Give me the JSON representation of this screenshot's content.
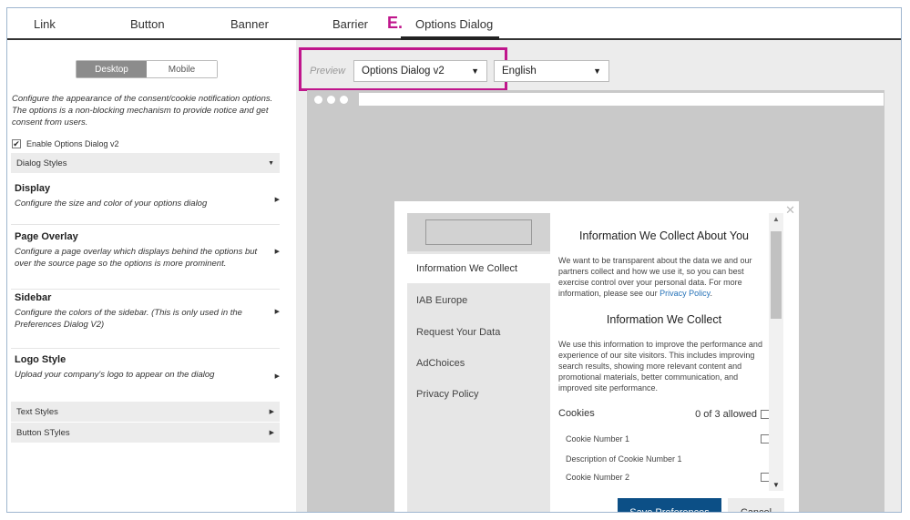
{
  "tabs": {
    "marker": "E.",
    "items": [
      "Link",
      "Button",
      "Banner",
      "Barrier",
      "Options Dialog"
    ]
  },
  "left": {
    "view_toggle": {
      "desktop": "Desktop",
      "mobile": "Mobile",
      "selected": "Desktop"
    },
    "intro": "Configure the appearance of the consent/cookie notification options. The options is a non-blocking mechanism to provide notice and get consent from users.",
    "enable_label": "Enable Options Dialog v2",
    "enable_checked": true,
    "dialog_styles_label": "Dialog Styles",
    "sections": [
      {
        "title": "Display",
        "desc": "Configure the size and color of your options dialog"
      },
      {
        "title": "Page Overlay",
        "desc": "Configure a page overlay which displays behind the options but over the source page so the options is more prominent."
      },
      {
        "title": "Sidebar",
        "desc": "Configure the colors of the sidebar. (This is only used in the Preferences Dialog V2)"
      },
      {
        "title": "Logo Style",
        "desc": "Upload your company's logo to appear on the dialog"
      }
    ],
    "text_styles_label": "Text Styles",
    "button_styles_label": "Button STyles"
  },
  "preview": {
    "label": "Preview",
    "dialog_select": "Options Dialog v2",
    "language_select": "English"
  },
  "dialog": {
    "nav": [
      "Information We Collect",
      "IAB Europe",
      "Request Your Data",
      "AdChoices",
      "Privacy Policy"
    ],
    "active_nav": "Information We Collect",
    "heading": "Information We Collect About You",
    "intro_text": "We want to be transparent about the data we and our partners collect and how we use it, so you can best exercise control over your personal data. For more information, please see our",
    "privacy_link": "Privacy Policy",
    "sub_heading": "Information We Collect",
    "body_text": "We use this information to improve the performance and experience of our site visitors. This includes improving search results, showing more relevant content and promotional materials, better communication, and improved site performance.",
    "cookies_label": "Cookies",
    "cookies_allowed": "0 of 3 allowed",
    "cookie_item": "Cookie Number 1",
    "cookie_desc": "Description of Cookie Number 1",
    "cookie_item_partial": "Cookie Number 2",
    "save_label": "Save Preferences",
    "cancel_label": "Cancel"
  },
  "colors": {
    "accent_magenta": "#c0168c",
    "primary_button": "#0c4f86",
    "link": "#2773b8"
  }
}
